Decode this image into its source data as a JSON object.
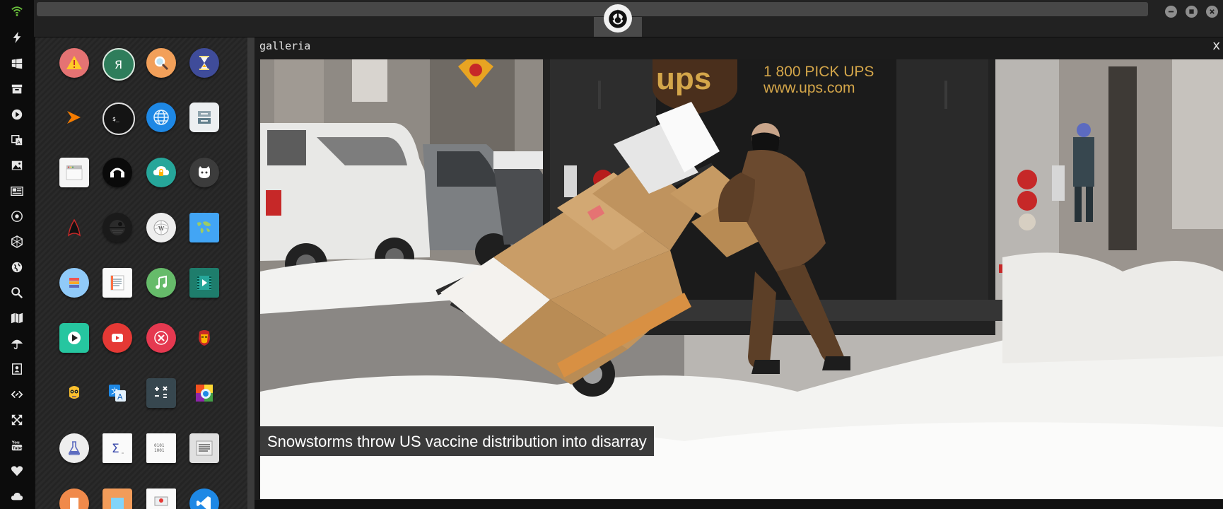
{
  "window": {
    "title": "galleria",
    "close_label": "x"
  },
  "caption": "Snowstorms throw US vaccine distribution into disarray",
  "photo": {
    "truck_brand": "ups",
    "truck_phone": "1 800 PICK UPS",
    "truck_url": "www.ups.com"
  },
  "dock_icons": [
    "wifi-icon",
    "bolt-icon",
    "windows-icon",
    "archive-icon",
    "play-icon",
    "translate-icon",
    "image-icon",
    "news-icon",
    "rebel-icon",
    "hexagon-icon",
    "globe-icon",
    "search-icon",
    "map-icon",
    "umbrella-icon",
    "contacts-icon",
    "code-icon",
    "expand-icon",
    "youtube-icon",
    "heart-icon",
    "cloud-icon"
  ],
  "apps": [
    "warning-app-icon",
    "yandex-app-icon",
    "search-app-icon",
    "hourglass-app-icon",
    "sublime-app-icon",
    "terminal-app-icon",
    "browser-globe-app-icon",
    "drive-app-icon",
    "window-app-icon",
    "headphones-app-icon",
    "cloud-lock-app-icon",
    "github-app-icon",
    "star-trek-app-icon",
    "death-star-app-icon",
    "wikipedia-app-icon",
    "world-map-app-icon",
    "library-app-icon",
    "notes-app-icon",
    "music-app-icon",
    "video-app-icon",
    "play-store-app-icon",
    "video-player-app-icon",
    "cancel-app-icon",
    "iron-man-app-icon",
    "c3po-app-icon",
    "translate-app-icon",
    "calculator-app-icon",
    "photos-app-icon",
    "lab-app-icon",
    "math-app-icon",
    "binary-app-icon",
    "text-app-icon",
    "document-app-icon",
    "picture-app-icon",
    "slides-app-icon",
    "vscode-app-icon"
  ],
  "colors": {
    "dock_background": "#0c0c0c",
    "topbar_background": "#222222",
    "wifi_accent": "#6abf3b",
    "caption_background": "#202020",
    "ups_brown": "#4a2f1c",
    "ups_gold": "#d4a64a"
  }
}
